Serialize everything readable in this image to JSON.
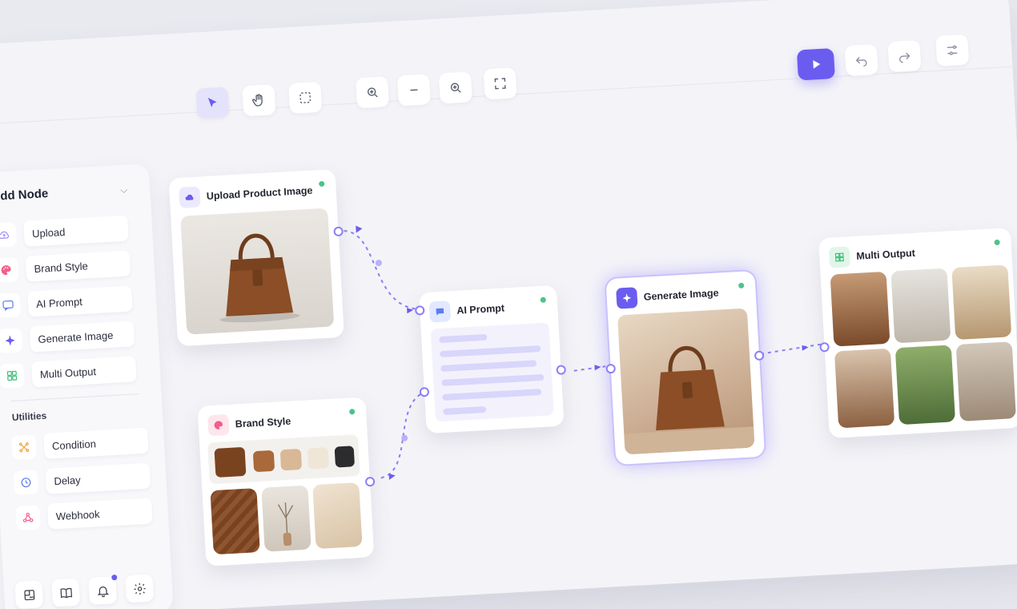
{
  "toolbar": {
    "tools": [
      "select-tool",
      "hand-tool",
      "marquee-tool",
      "zoom-in",
      "zoom-out-minus",
      "zoom-fit",
      "fit-screen"
    ],
    "run_label": "",
    "undo": "undo",
    "redo": "redo",
    "settings": "settings"
  },
  "sidebar": {
    "title": "Add Node",
    "items": [
      {
        "label": "Upload",
        "icon": "cloud-upload-icon",
        "color": "#a48cf8"
      },
      {
        "label": "Brand Style",
        "icon": "palette-icon",
        "color": "#f25f8a"
      },
      {
        "label": "AI Prompt",
        "icon": "chat-icon",
        "color": "#5b7cf2"
      },
      {
        "label": "Generate Image",
        "icon": "sparkle-icon",
        "color": "#6b5cf0"
      },
      {
        "label": "Multi Output",
        "icon": "grid-icon",
        "color": "#3fbf78"
      }
    ],
    "utilities_title": "Utilities",
    "utilities": [
      {
        "label": "Condition",
        "icon": "branch-icon",
        "color": "#f2a33a"
      },
      {
        "label": "Delay",
        "icon": "clock-icon",
        "color": "#5b7cf2"
      },
      {
        "label": "Webhook",
        "icon": "webhook-icon",
        "color": "#f25f8a"
      }
    ]
  },
  "nodes": {
    "upload": {
      "title": "Upload Product Image"
    },
    "brand": {
      "title": "Brand Style",
      "swatches": [
        "#7a4320",
        "#a9693a",
        "#d9b896",
        "#efe6d8",
        "#2c2c2e"
      ]
    },
    "prompt": {
      "title": "AI Prompt"
    },
    "generate": {
      "title": "Generate Image"
    },
    "multi": {
      "title": "Multi Output"
    }
  },
  "colors": {
    "accent": "#6b5cf0",
    "status": "#4cc38a"
  }
}
